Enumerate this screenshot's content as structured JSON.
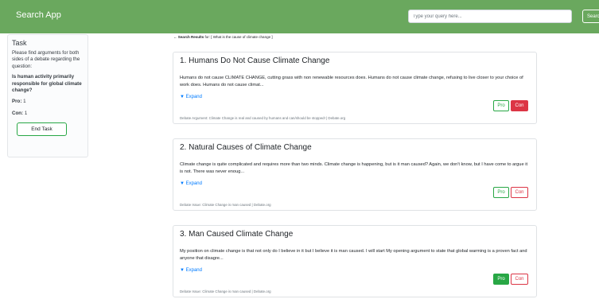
{
  "navbar": {
    "brand": "Search App",
    "search_placeholder": "Type your query here...",
    "search_button": "Search"
  },
  "task": {
    "title": "Task",
    "description": "Please find arguments for both sides of a debate regarding the question:",
    "question": "Is human activity primarily responsible for global climate change?",
    "pro_label": "Pro:",
    "pro_count": "1",
    "con_label": "Con:",
    "con_count": "1",
    "end_button": "End Task"
  },
  "results": {
    "prefix": "← ",
    "label": "Search Results",
    "query_text": " for: [ What is the cause of climate change ]"
  },
  "cards": [
    {
      "title": "1. Humans Do Not Cause Climate Change",
      "body": "Humans do not cause CLIMATE CHANGE, cutting grass with non renewable resources does. Humans do not cause climate change, refusing to live closer to your choice of work does. Humans do not cause climat...",
      "expand": "▼ Expand",
      "pro": "Pro",
      "con": "Con",
      "selected": "con",
      "footer": "Debate Argument: Climate Change is real and caused by humans and can/should be stopped! | Debate.org"
    },
    {
      "title": "2. Natural Causes of Climate Change",
      "body": "Climate change is quite complicated and requires more than two minds. Climate change is happening, but is it man caused? Again, we don't know, but I have come to argue it is not. There was never enoug...",
      "expand": "▼ Expand",
      "pro": "Pro",
      "con": "Con",
      "selected": "none",
      "footer": "Debate Issue: Climate Change is man caused | Debate.org"
    },
    {
      "title": "3. Man Caused Climate Change",
      "body": "My position on climate change is that not only do I believe in it but I believe it is man caused. I will start My opening argument to state that global warming is a proven fact and anyone that disagre...",
      "expand": "▼ Expand",
      "pro": "Pro",
      "con": "Con",
      "selected": "pro",
      "footer": "Debate Issue: Climate Change is man caused | Debate.org"
    }
  ]
}
